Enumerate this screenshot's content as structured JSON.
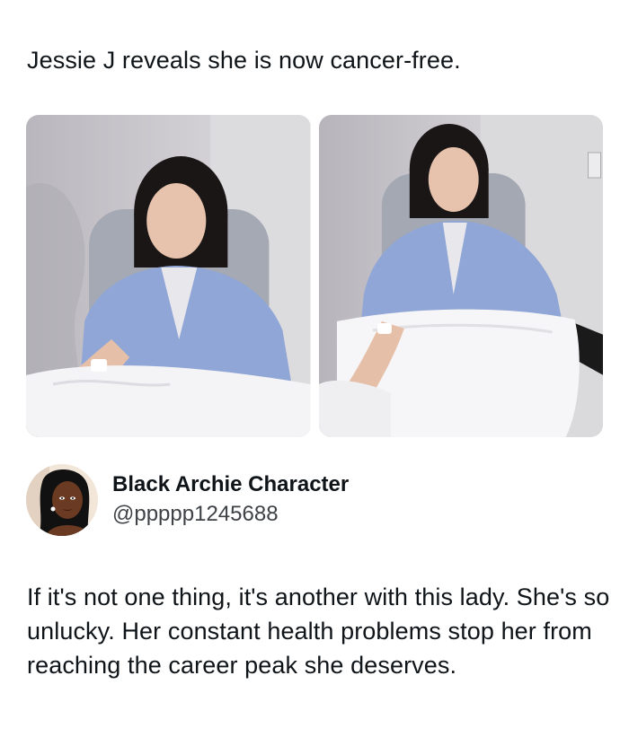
{
  "post": {
    "headline": "Jessie J reveals she is now cancer-free.",
    "images": [
      {
        "icon": "photo-hospital-gown-left"
      },
      {
        "icon": "photo-hospital-gown-right"
      }
    ]
  },
  "author": {
    "display_name": "Black Archie Character",
    "handle": "@ppppp1245688",
    "avatar_icon": "cartoon-avatar"
  },
  "tweet": {
    "text": "If it's not one thing, it's another with this lady. She's so unlucky. Her constant health problems stop her from reaching the career peak she deserves."
  },
  "colors": {
    "text": "#0f1419",
    "secondary": "#3e4246",
    "gown": "#8fa6d6",
    "wall": "#c9c8cf"
  }
}
